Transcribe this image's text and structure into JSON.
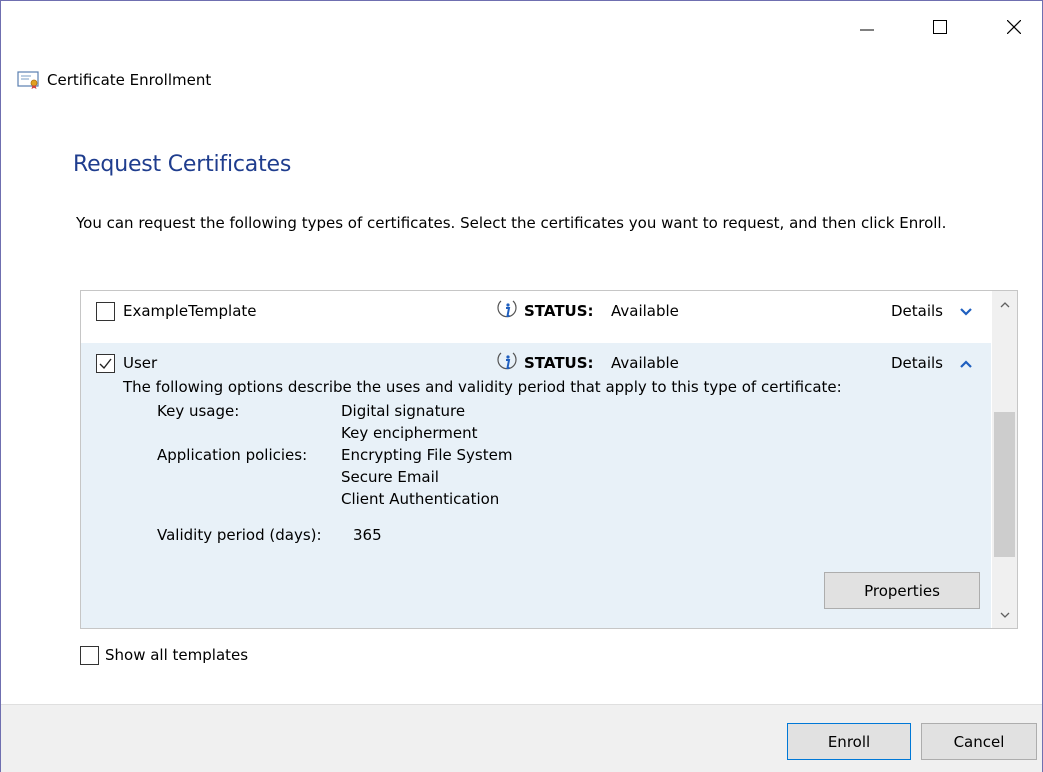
{
  "window": {
    "title": "Certificate Enrollment"
  },
  "page": {
    "heading": "Request Certificates",
    "description": "You can request the following types of certificates. Select the certificates you want to request, and then click Enroll."
  },
  "templates": [
    {
      "name": "ExampleTemplate",
      "checked": false,
      "status_label": "STATUS:",
      "status_value": "Available",
      "details_label": "Details",
      "expanded": false
    },
    {
      "name": "User",
      "checked": true,
      "status_label": "STATUS:",
      "status_value": "Available",
      "details_label": "Details",
      "expanded": true,
      "options_description": "The following options describe the uses and validity period that apply to this type of certificate:",
      "key_usage_label": "Key usage:",
      "key_usage": [
        "Digital signature",
        "Key encipherment"
      ],
      "application_policies_label": "Application policies:",
      "application_policies": [
        "Encrypting File System",
        "Secure Email",
        "Client Authentication"
      ],
      "validity_label": "Validity period (days):",
      "validity_value": "365",
      "properties_label": "Properties"
    }
  ],
  "show_all": {
    "label": "Show all templates",
    "checked": false
  },
  "buttons": {
    "enroll": "Enroll",
    "cancel": "Cancel"
  },
  "colors": {
    "heading": "#1f3d8e",
    "selected_row": "#e8f1f8",
    "footer": "#f0f0f0",
    "chevron": "#1f5fbf"
  }
}
